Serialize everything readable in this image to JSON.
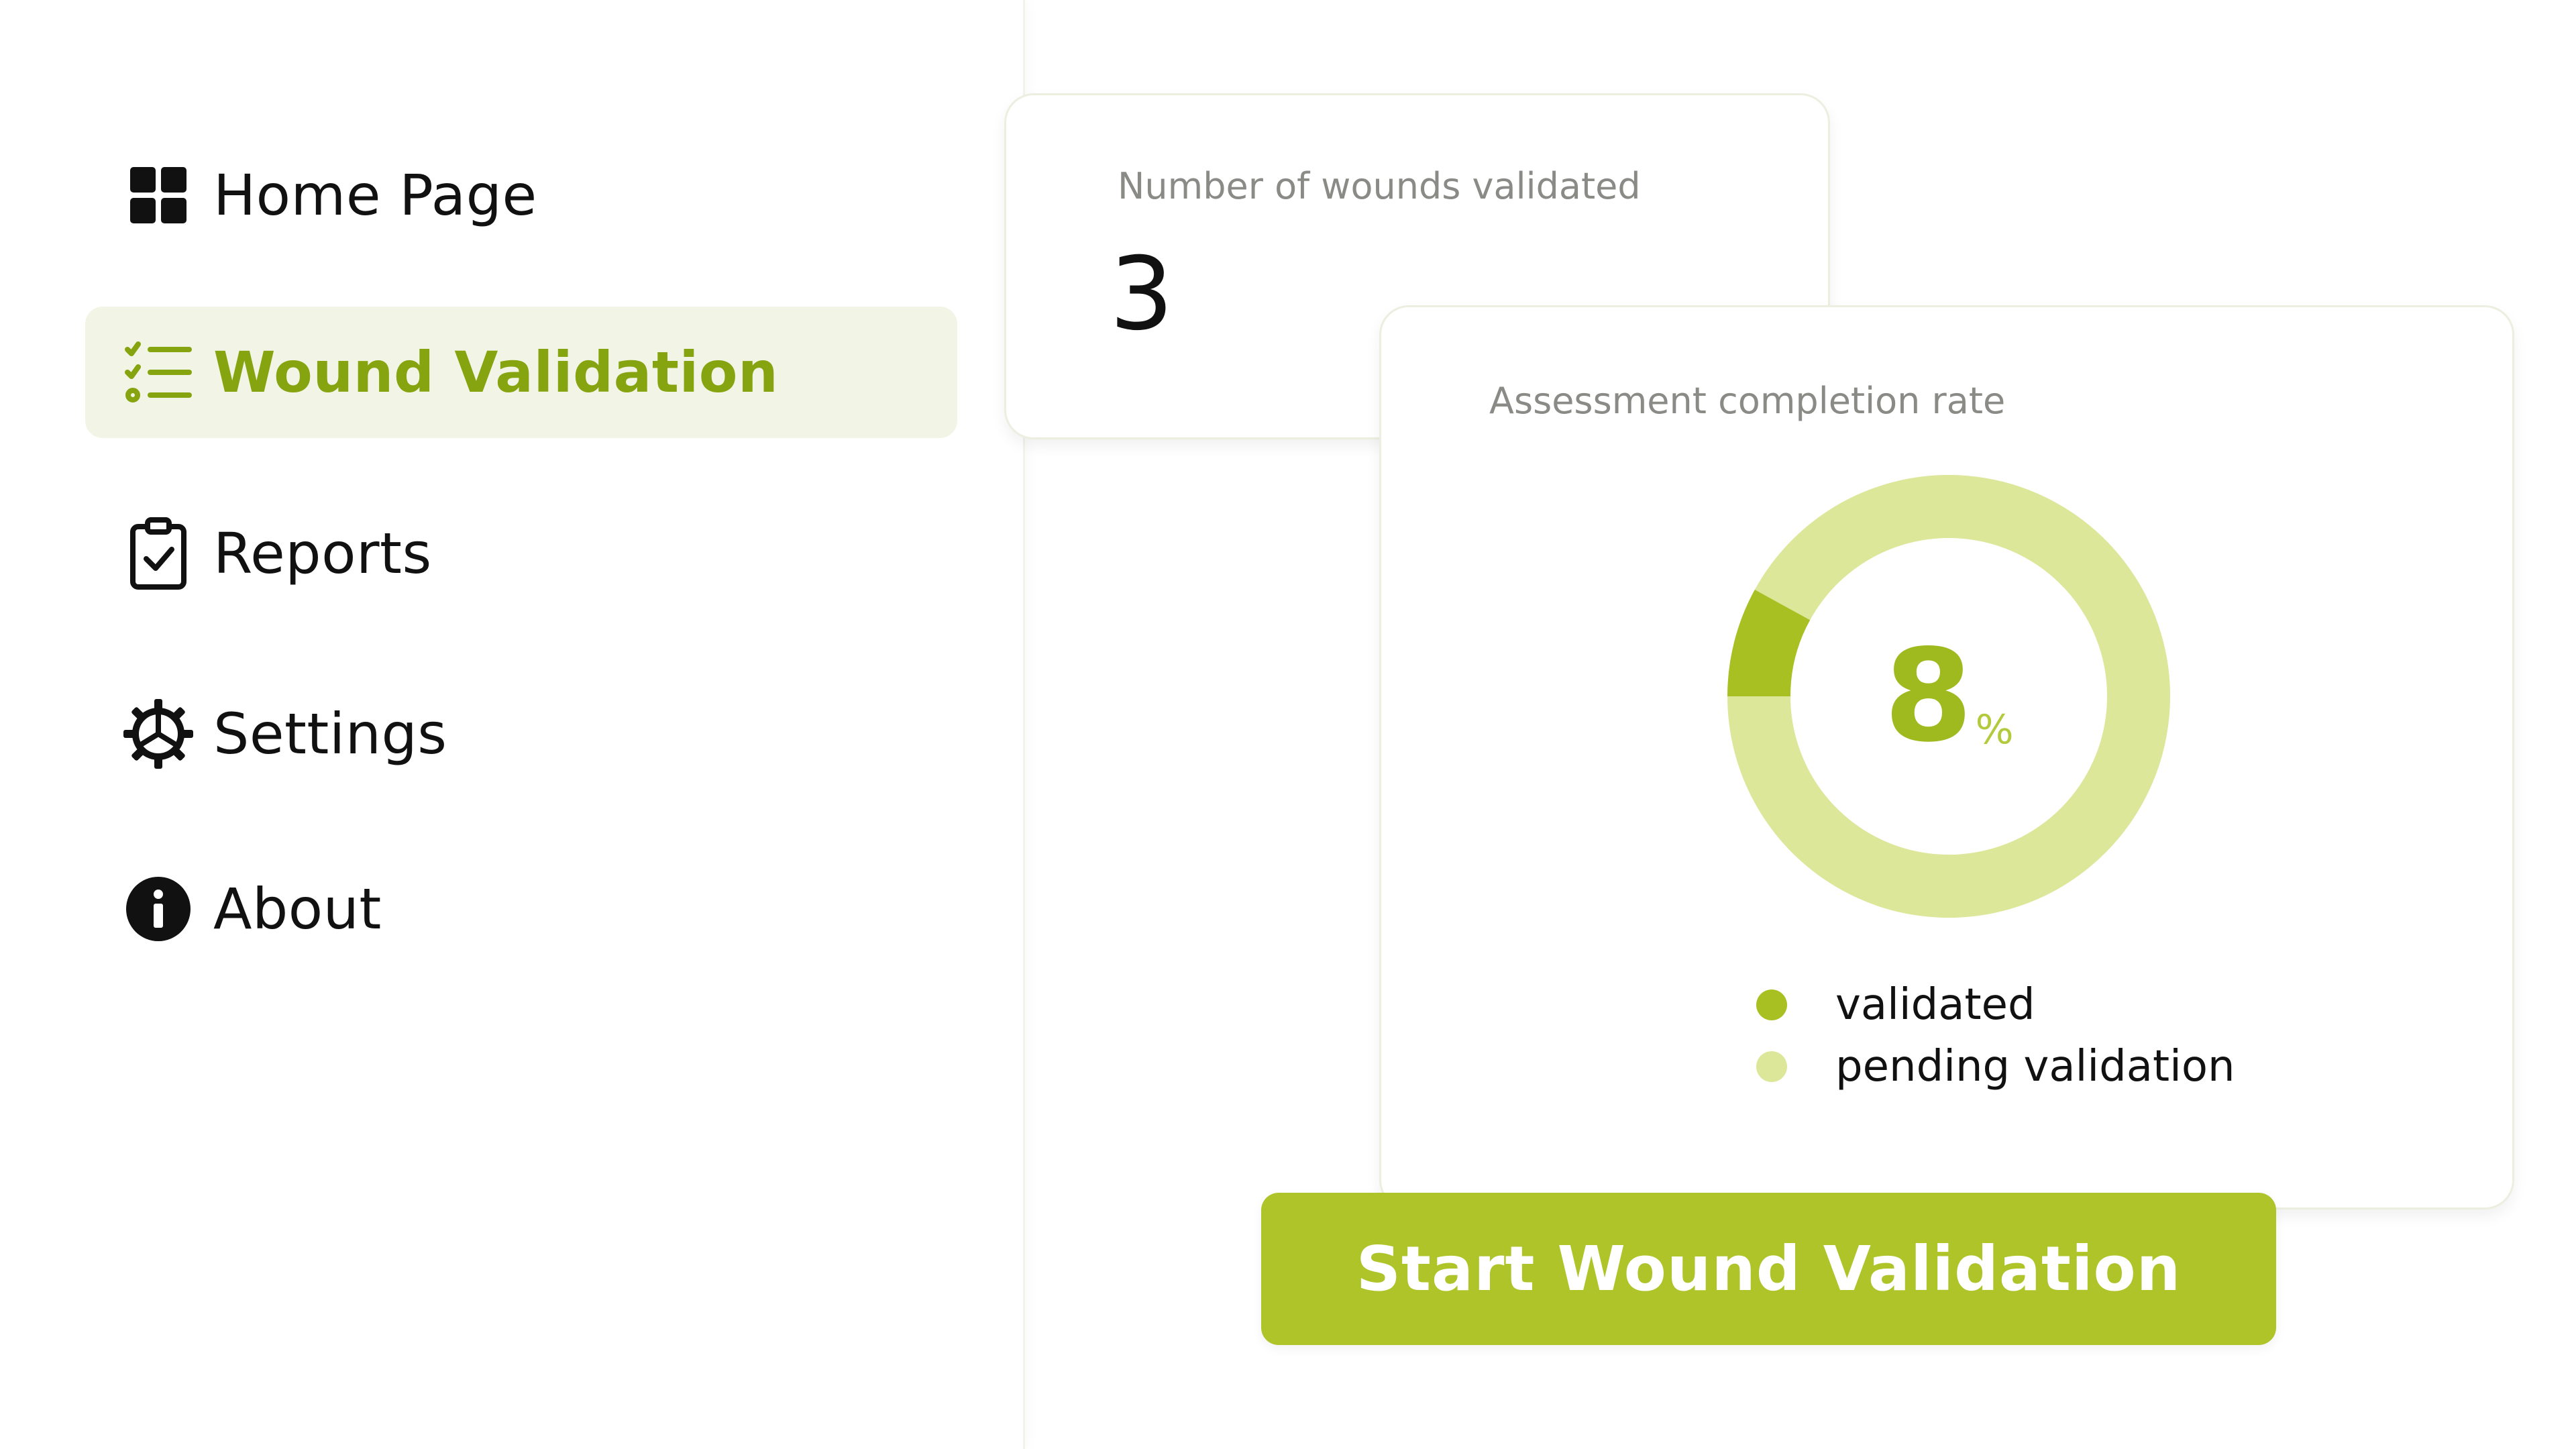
{
  "sidebar": {
    "items": [
      {
        "label": "Home Page",
        "icon": "grid-icon",
        "active": false
      },
      {
        "label": "Wound Validation",
        "icon": "checklist-icon",
        "active": true
      },
      {
        "label": "Reports",
        "icon": "clipboard-check-icon",
        "active": false
      },
      {
        "label": "Settings",
        "icon": "gear-icon",
        "active": false
      },
      {
        "label": "About",
        "icon": "info-icon",
        "active": false
      }
    ]
  },
  "wounds_card": {
    "label": "Number of wounds validated",
    "value": "3"
  },
  "rate_card": {
    "label": "Assessment completion rate",
    "percent": "8",
    "percent_sign": "%",
    "legend": [
      {
        "label": "validated",
        "color": "#a9c023"
      },
      {
        "label": "pending validation",
        "color": "#dce799"
      }
    ]
  },
  "chart_data": {
    "type": "pie",
    "categories": [
      "validated",
      "pending validation"
    ],
    "values": [
      8,
      92
    ],
    "colors": [
      "#a9c023",
      "#dce799"
    ]
  },
  "actions": {
    "start_label": "Start Wound Validation"
  },
  "colors": {
    "accent": "#afc429",
    "active_text": "#86a40f",
    "active_bg": "#f2f4e6"
  }
}
